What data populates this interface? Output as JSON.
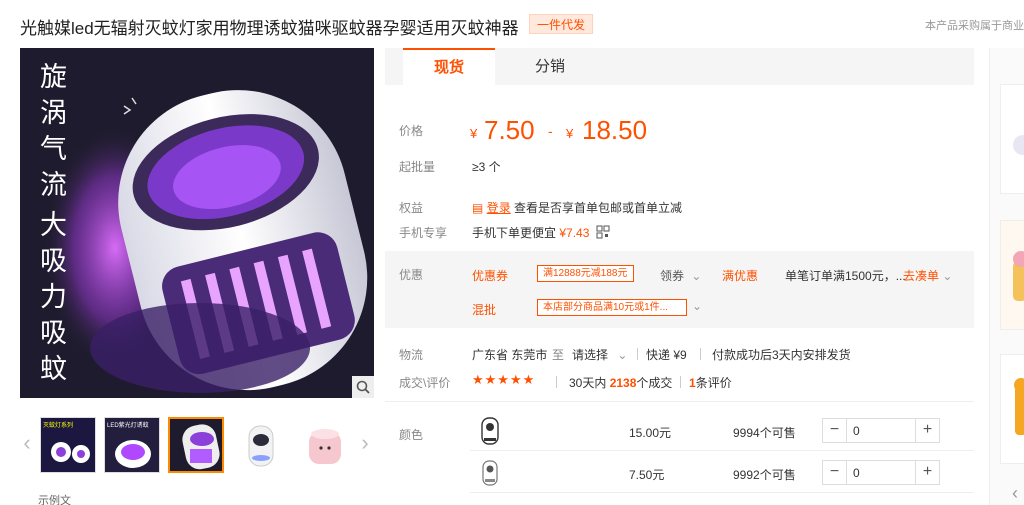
{
  "header": {
    "title": "光触媒led无辐射灭蚊灯家用物理诱蚊猫咪驱蚊器孕婴适用灭蚊神器",
    "badge": "一件代发",
    "right_note": "本产品采购属于商业"
  },
  "gallery": {
    "overlay_line1": "旋涡气流",
    "overlay_line2": "大吸力吸蚊",
    "thumb_text_1": "灭蚊灯系列",
    "thumb_text_2": "LED紫光灯诱蚊",
    "bottom_text": "示例文"
  },
  "tabs": {
    "active": "现货",
    "other": "分销"
  },
  "price": {
    "label": "价格",
    "symbol": "¥",
    "low": "7.50",
    "dash": "-",
    "high": "18.50"
  },
  "moq": {
    "label": "起批量",
    "value": "≥3 个"
  },
  "benefit": {
    "label": "权益",
    "login": "登录",
    "text": "查看是否享首单包邮或首单立减"
  },
  "mobile": {
    "label": "手机专享",
    "text": "手机下单更便宜",
    "price": "¥7.43"
  },
  "promo": {
    "label": "优惠",
    "coupon_label": "优惠券",
    "coupon_tag": "满12888元减188元",
    "get_coupon": "领券",
    "full_discount_label": "满优惠",
    "full_discount_text": "单笔订单满1500元，...",
    "go_order": "去凑单",
    "mix_label": "混批",
    "mix_tag": "本店部分商品满10元或1件..."
  },
  "logistics": {
    "label": "物流",
    "from": "广东省 东莞市",
    "to_word": "至",
    "choose": "请选择",
    "express": "快递 ¥9",
    "ship_note": "付款成功后3天内安排发货"
  },
  "reviews": {
    "label": "成交\\评价",
    "stars": "★★★★★",
    "sold_prefix": "30天内",
    "sold_count": "2138",
    "sold_suffix": "个成交",
    "review_count": "1",
    "review_suffix": "条评价"
  },
  "sku": {
    "label": "颜色",
    "rows": [
      {
        "price": "15.00元",
        "stock": "9994个可售",
        "qty": "0"
      },
      {
        "price": "7.50元",
        "stock": "9992个可售",
        "qty": "0"
      }
    ]
  },
  "colors": {
    "accent": "#ff5000"
  }
}
